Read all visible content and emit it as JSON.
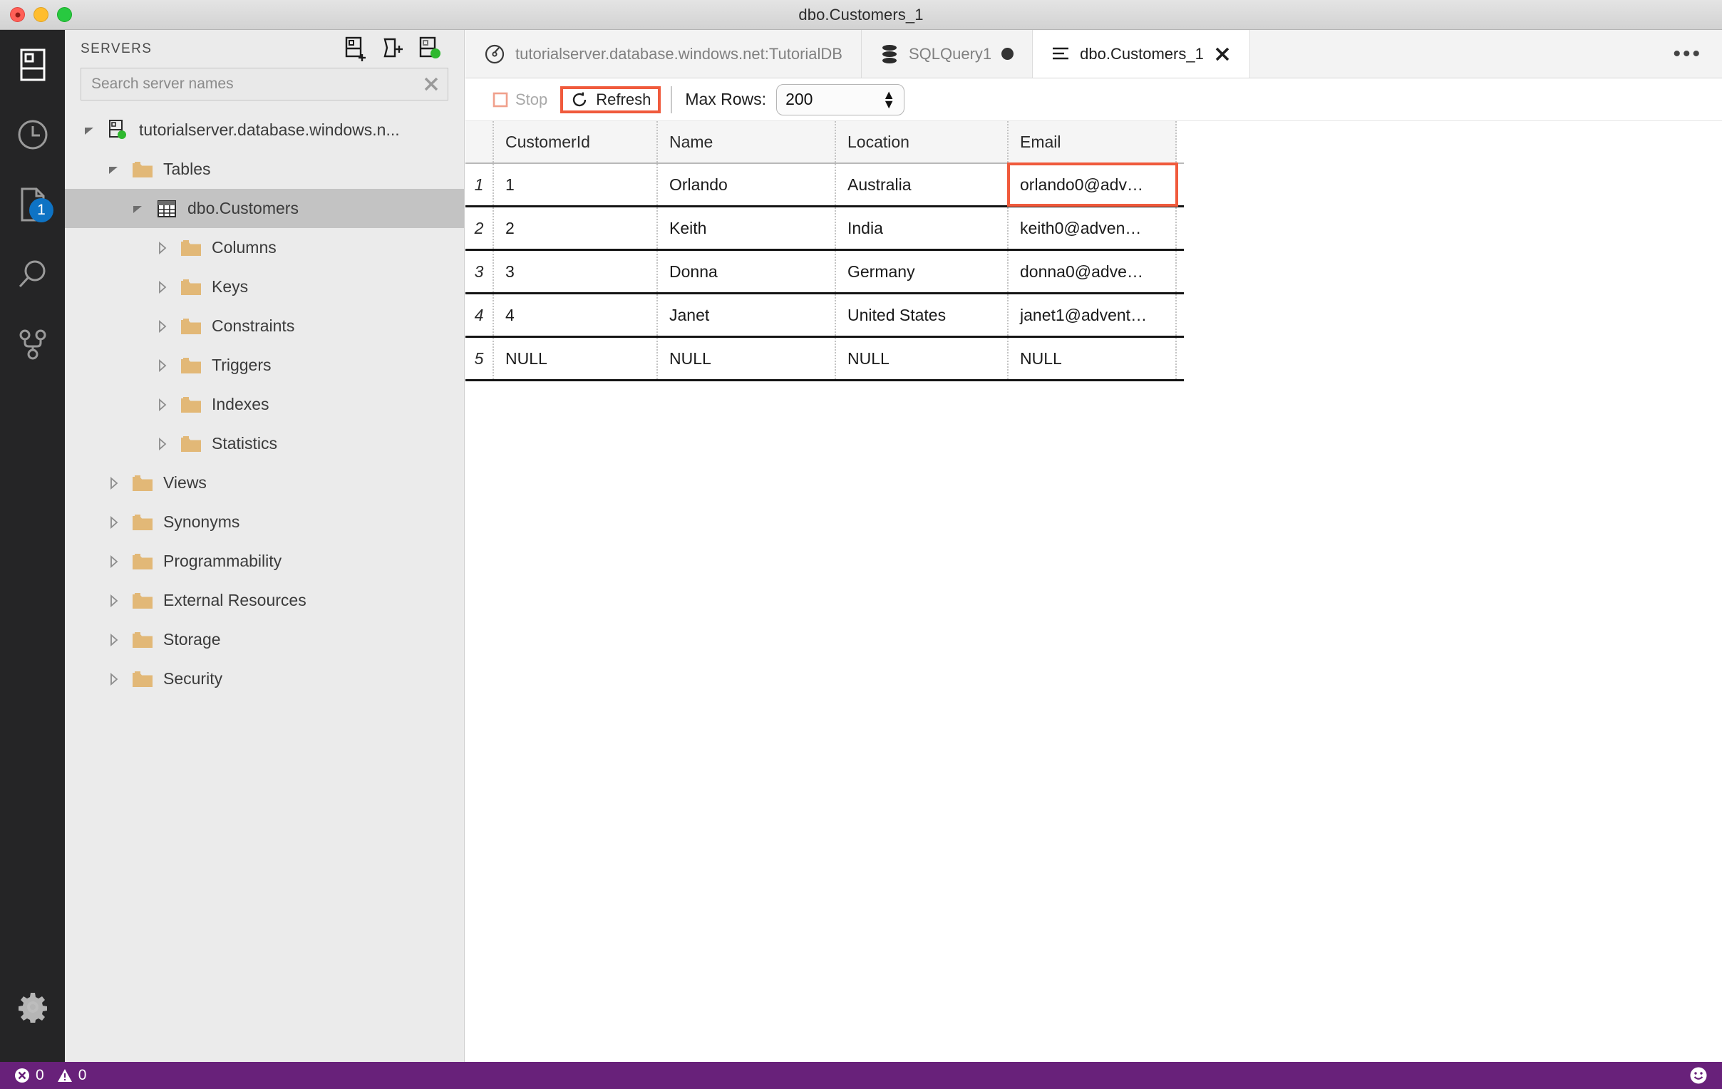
{
  "window": {
    "title": "dbo.Customers_1",
    "traffic_lights": [
      "close",
      "minimize",
      "maximize"
    ]
  },
  "activity_bar": {
    "items": [
      {
        "name": "servers-icon",
        "label": "Servers",
        "active": true,
        "badge": null
      },
      {
        "name": "history-icon",
        "label": "Query History",
        "active": false,
        "badge": null
      },
      {
        "name": "tasks-icon",
        "label": "Tasks",
        "active": false,
        "badge": "1"
      },
      {
        "name": "search-icon",
        "label": "Search",
        "active": false,
        "badge": null
      },
      {
        "name": "source-control-icon",
        "label": "Source Control",
        "active": false,
        "badge": null
      }
    ],
    "settings": {
      "name": "gear-icon",
      "label": "Manage"
    }
  },
  "sidebar": {
    "title": "SERVERS",
    "tools": [
      {
        "name": "new-connection-icon",
        "label": "New Connection"
      },
      {
        "name": "new-server-group-icon",
        "label": "New Server Group"
      },
      {
        "name": "active-connections-icon",
        "label": "Show Active Connections"
      }
    ],
    "search": {
      "placeholder": "Search server names",
      "value": "",
      "clear_label": "×"
    },
    "tree": [
      {
        "label": "tutorialserver.database.windows.n...",
        "icon": "server-connected-icon",
        "indent": 0,
        "twisty": "down",
        "selected": false
      },
      {
        "label": "Tables",
        "icon": "folder-icon",
        "indent": 1,
        "twisty": "down",
        "selected": false
      },
      {
        "label": "dbo.Customers",
        "icon": "table-icon",
        "indent": 2,
        "twisty": "down",
        "selected": true
      },
      {
        "label": "Columns",
        "icon": "folder-icon",
        "indent": 3,
        "twisty": "right",
        "selected": false
      },
      {
        "label": "Keys",
        "icon": "folder-icon",
        "indent": 3,
        "twisty": "right",
        "selected": false
      },
      {
        "label": "Constraints",
        "icon": "folder-icon",
        "indent": 3,
        "twisty": "right",
        "selected": false
      },
      {
        "label": "Triggers",
        "icon": "folder-icon",
        "indent": 3,
        "twisty": "right",
        "selected": false
      },
      {
        "label": "Indexes",
        "icon": "folder-icon",
        "indent": 3,
        "twisty": "right",
        "selected": false
      },
      {
        "label": "Statistics",
        "icon": "folder-icon",
        "indent": 3,
        "twisty": "right",
        "selected": false
      },
      {
        "label": "Views",
        "icon": "folder-icon",
        "indent": 1,
        "twisty": "right",
        "selected": false
      },
      {
        "label": "Synonyms",
        "icon": "folder-icon",
        "indent": 1,
        "twisty": "right",
        "selected": false
      },
      {
        "label": "Programmability",
        "icon": "folder-icon",
        "indent": 1,
        "twisty": "right",
        "selected": false
      },
      {
        "label": "External Resources",
        "icon": "folder-icon",
        "indent": 1,
        "twisty": "right",
        "selected": false
      },
      {
        "label": "Storage",
        "icon": "folder-icon",
        "indent": 1,
        "twisty": "right",
        "selected": false
      },
      {
        "label": "Security",
        "icon": "folder-icon",
        "indent": 1,
        "twisty": "right",
        "selected": false
      }
    ]
  },
  "editor": {
    "tabs": [
      {
        "label": "tutorialserver.database.windows.net:TutorialDB",
        "icon": "dashboard-icon",
        "active": false,
        "dirty": false,
        "closable": false
      },
      {
        "label": "SQLQuery1",
        "icon": "database-icon",
        "active": false,
        "dirty": true,
        "closable": false
      },
      {
        "label": "dbo.Customers_1",
        "icon": "edit-data-icon",
        "active": true,
        "dirty": false,
        "closable": true
      }
    ],
    "tab_overflow": "•••",
    "toolbar": {
      "stop_label": "Stop",
      "stop_disabled": true,
      "refresh_label": "Refresh",
      "refresh_highlighted": true,
      "max_rows_label": "Max Rows:",
      "max_rows_value": "200"
    },
    "grid": {
      "columns": [
        "CustomerId",
        "Name",
        "Location",
        "Email"
      ],
      "rows": [
        {
          "num": "1",
          "CustomerId": "1",
          "Name": "Orlando",
          "Location": "Australia",
          "Email": "orlando0@adv…"
        },
        {
          "num": "2",
          "CustomerId": "2",
          "Name": "Keith",
          "Location": "India",
          "Email": "keith0@adven…"
        },
        {
          "num": "3",
          "CustomerId": "3",
          "Name": "Donna",
          "Location": "Germany",
          "Email": "donna0@adve…"
        },
        {
          "num": "4",
          "CustomerId": "4",
          "Name": "Janet",
          "Location": "United States",
          "Email": "janet1@advent…"
        },
        {
          "num": "5",
          "CustomerId": "NULL",
          "Name": "NULL",
          "Location": "NULL",
          "Email": "NULL"
        }
      ],
      "highlighted_cell": {
        "row": 1,
        "column": "Email"
      }
    }
  },
  "status_bar": {
    "errors": {
      "icon": "error-icon",
      "count": "0"
    },
    "warnings": {
      "icon": "warning-icon",
      "count": "0"
    },
    "feedback": {
      "icon": "smiley-icon"
    }
  },
  "colors": {
    "accent_annotation": "#f05a3c",
    "status_bar": "#68217a",
    "badge": "#0e73c4",
    "folder": "#e2b877",
    "connected_dot": "#2eb82e"
  }
}
